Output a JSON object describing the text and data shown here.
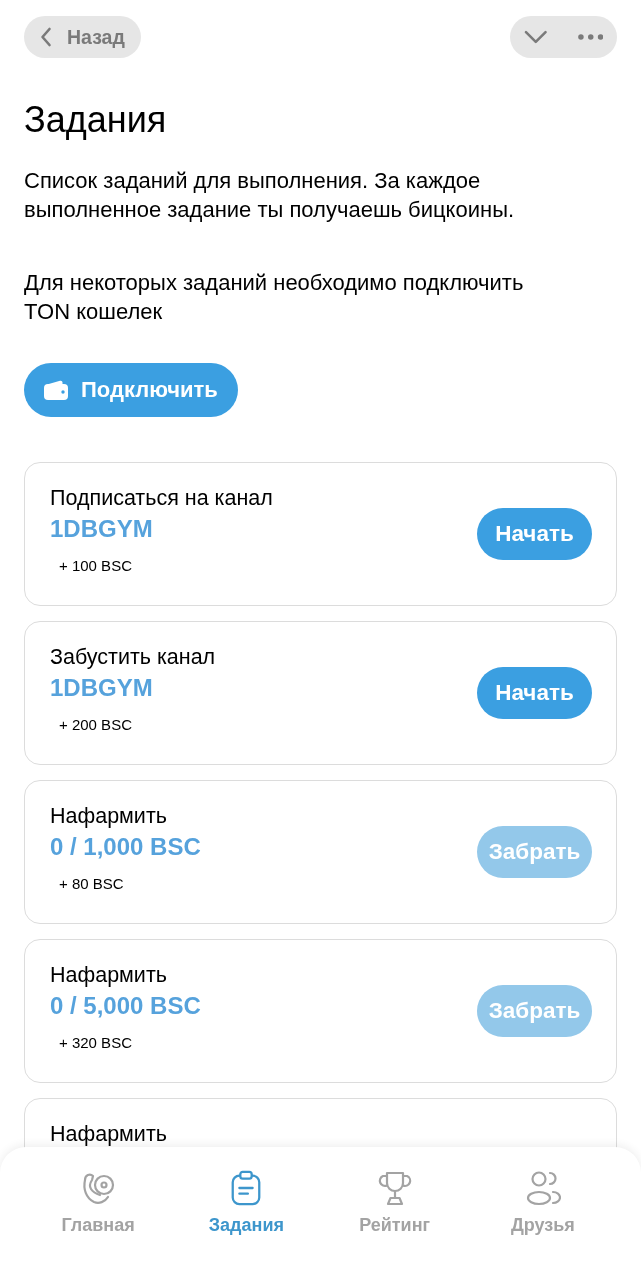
{
  "top_bar": {
    "back_label": "Назад"
  },
  "title": "Задания",
  "paragraphs": [
    "Список заданий для выполнения. За каждое выполненное задание ты получаешь бицкоины.",
    "Для некоторых заданий необходимо подключить TON кошелек"
  ],
  "connect_button": {
    "label": "Подключить"
  },
  "tasks": [
    {
      "title": "Подписаться на канал",
      "value": "1DBGYM",
      "reward": "+ 100 BSC",
      "button": {
        "label": "Начать",
        "disabled": false
      }
    },
    {
      "title": "Забустить канал",
      "value": "1DBGYM",
      "reward": "+ 200 BSC",
      "button": {
        "label": "Начать",
        "disabled": false
      }
    },
    {
      "title": "Нафармить",
      "value": "0 / 1,000 BSC",
      "reward": "+ 80 BSC",
      "button": {
        "label": "Забрать",
        "disabled": true
      }
    },
    {
      "title": "Нафармить",
      "value": "0 / 5,000 BSC",
      "reward": "+ 320 BSC",
      "button": {
        "label": "Забрать",
        "disabled": true
      }
    },
    {
      "title": "Нафармить"
    }
  ],
  "bottom_nav": {
    "items": [
      {
        "label": "Главная",
        "selected": false
      },
      {
        "label": "Задания",
        "selected": true
      },
      {
        "label": "Рейтинг",
        "selected": false
      },
      {
        "label": "Друзья",
        "selected": false
      }
    ]
  }
}
